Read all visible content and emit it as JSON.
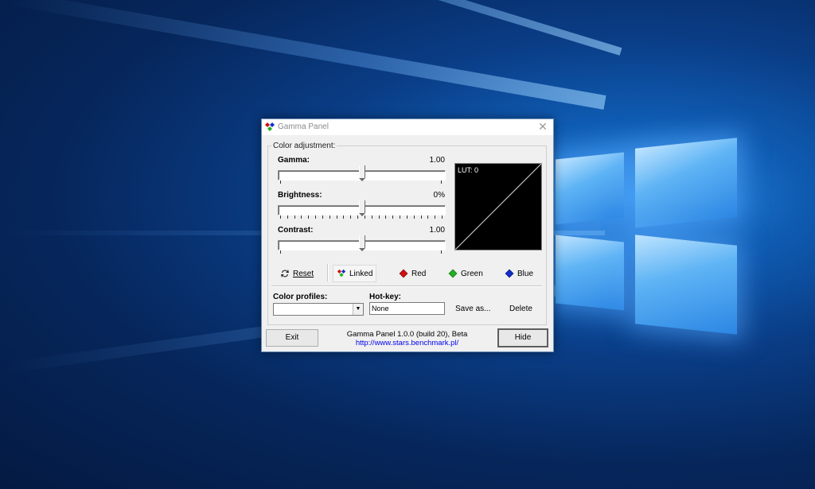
{
  "window": {
    "title": "Gamma Panel",
    "close_glyph": "✕"
  },
  "color_adjustment": {
    "group_label": "Color adjustment:",
    "gamma": {
      "label": "Gamma:",
      "value": "1.00",
      "level": 0.5
    },
    "brightness": {
      "label": "Brightness:",
      "value": "0%",
      "level": 0.5
    },
    "contrast": {
      "label": "Contrast:",
      "value": "1.00",
      "level": 0.5
    },
    "lut_label": "LUT: 0"
  },
  "channel_buttons": {
    "reset": "Reset",
    "linked": "Linked",
    "red": "Red",
    "green": "Green",
    "blue": "Blue"
  },
  "profiles": {
    "label": "Color profiles:",
    "selected": "",
    "hotkey_label": "Hot-key:",
    "hotkey_value": "None",
    "save_as": "Save as...",
    "delete": "Delete"
  },
  "footer": {
    "exit": "Exit",
    "version": "Gamma Panel 1.0.0 (build 20), Beta",
    "url": "http://www.stars.benchmark.pl/",
    "hide": "Hide"
  },
  "colors": {
    "red": "#d01010",
    "green": "#22b022",
    "blue": "#1030c8"
  },
  "icons": [
    "app-icon",
    "close-icon",
    "reset-icon",
    "linked-icon",
    "red-diamond-icon",
    "green-diamond-icon",
    "blue-diamond-icon",
    "dropdown-arrow-icon"
  ]
}
